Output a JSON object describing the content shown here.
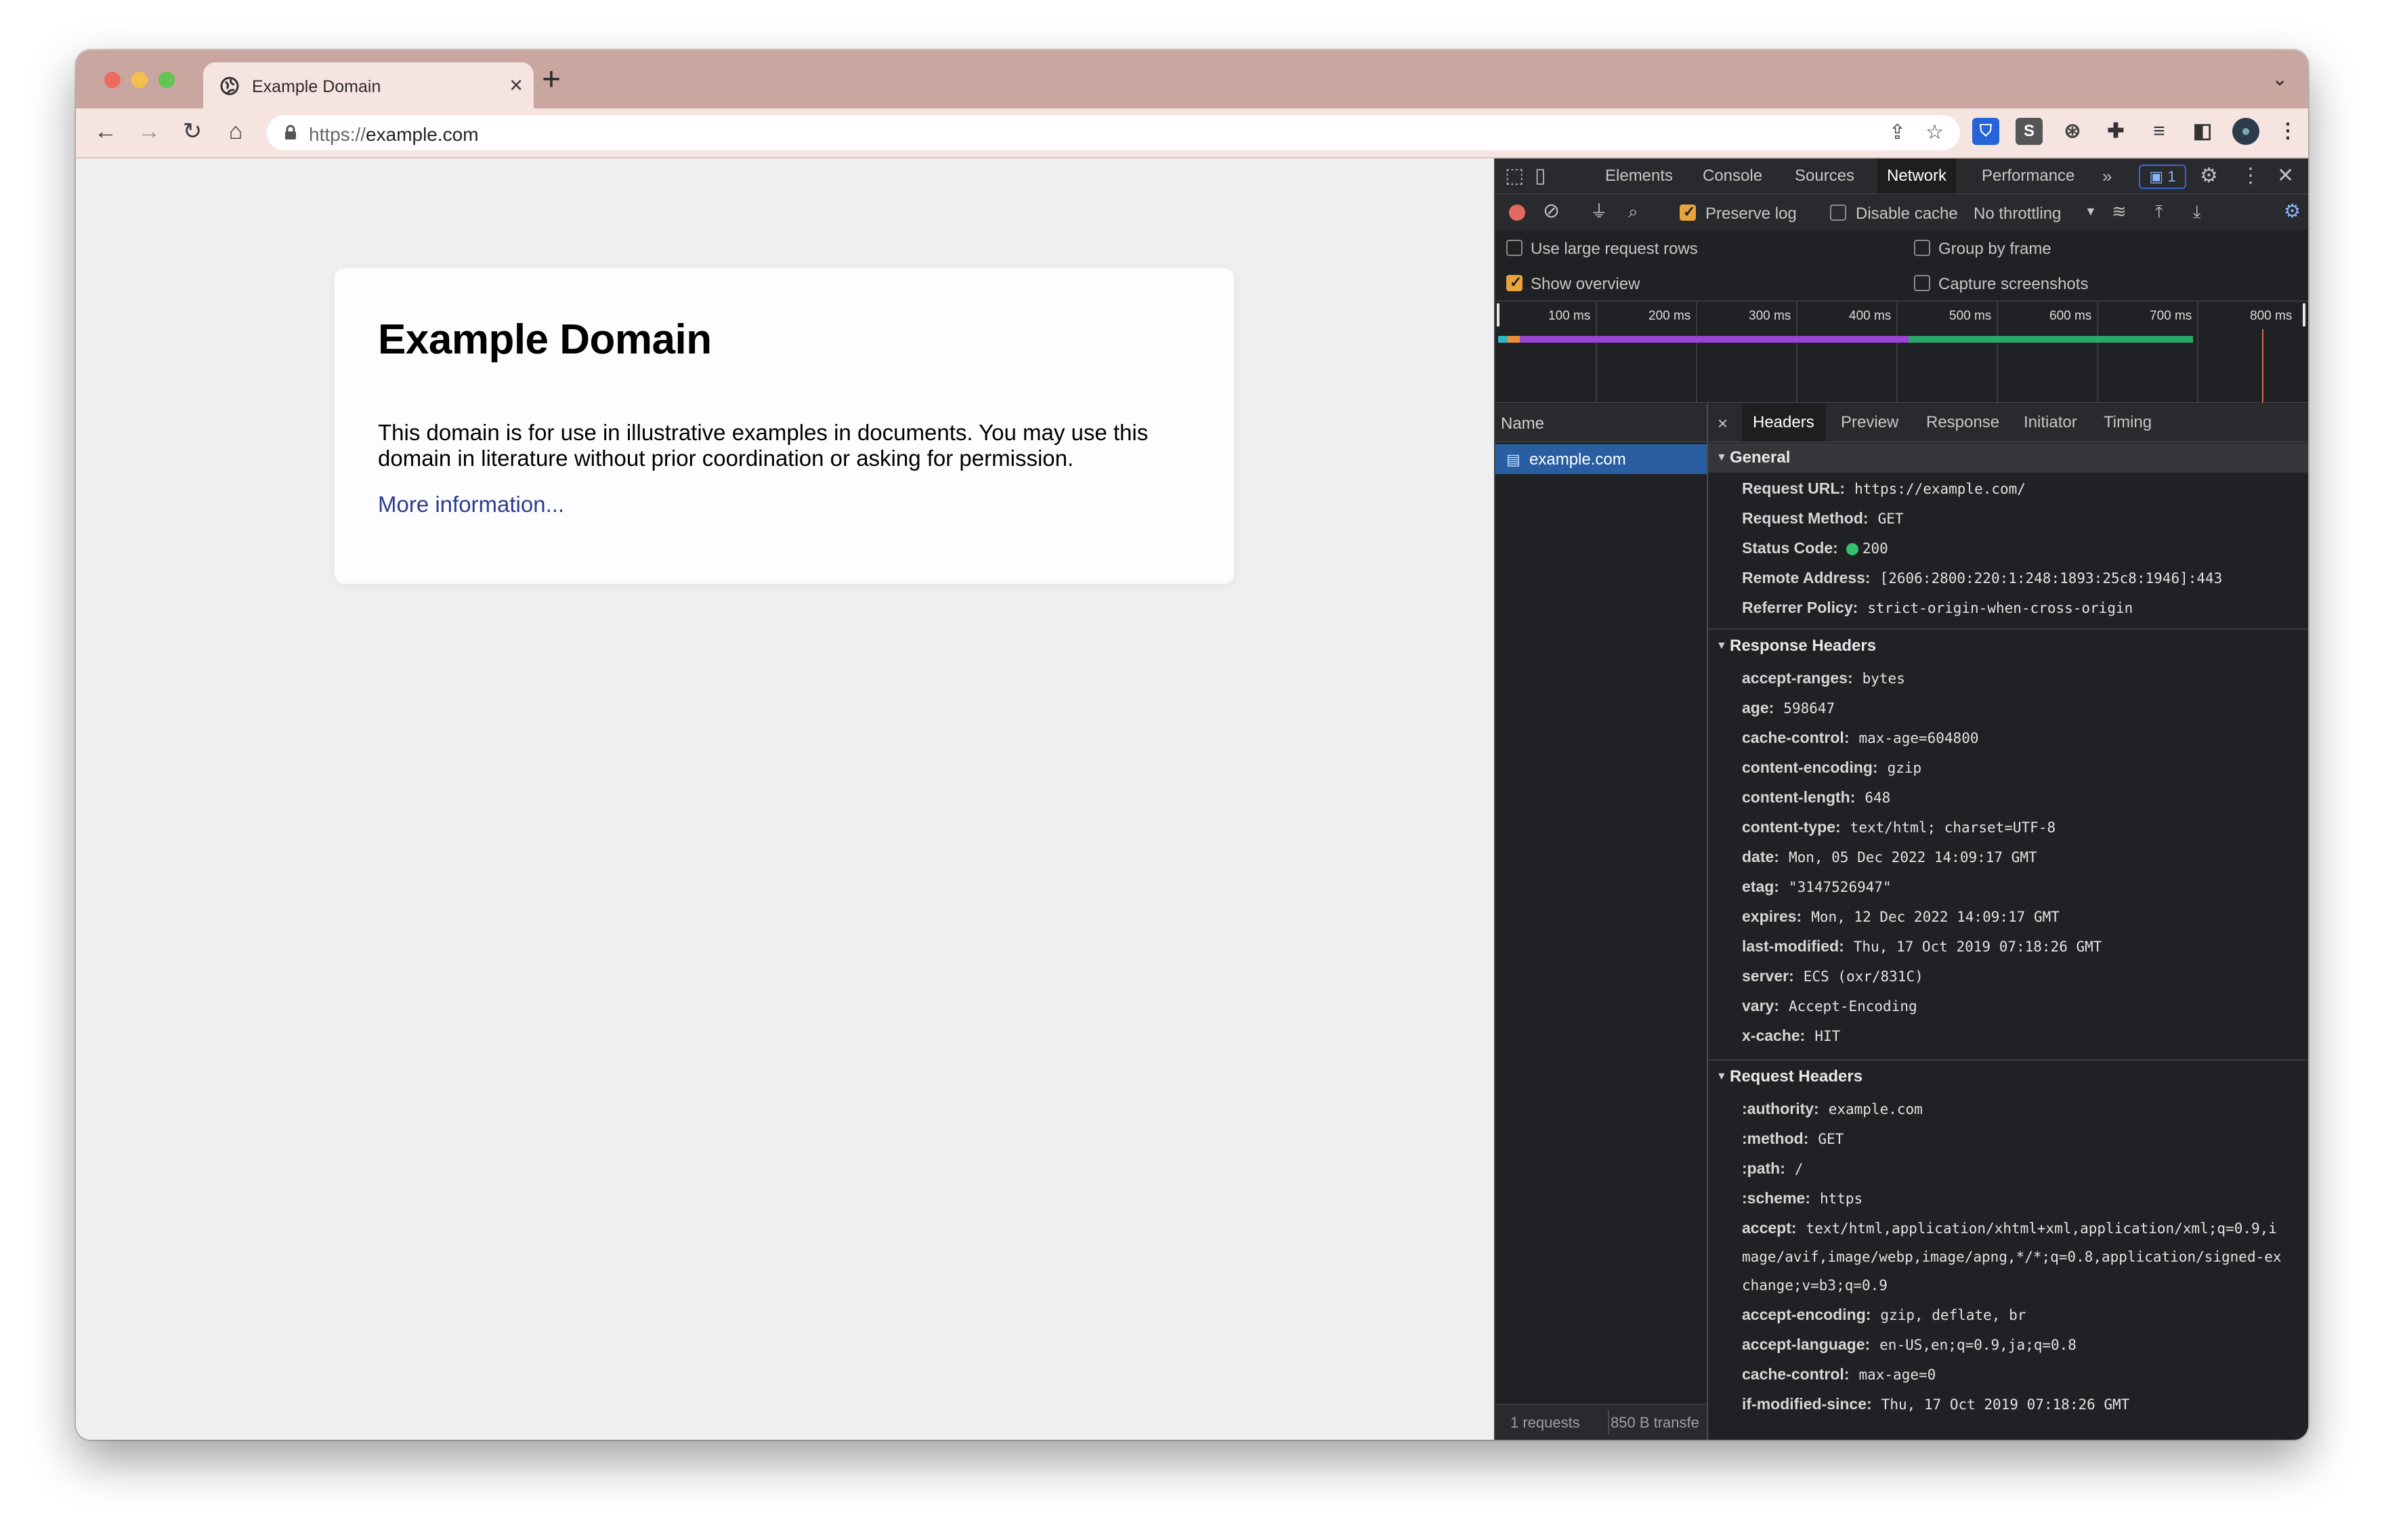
{
  "tab": {
    "title": "Example Domain"
  },
  "address_bar": {
    "scheme": "https://",
    "host": "example.com"
  },
  "page": {
    "heading": "Example Domain",
    "paragraph": "This domain is for use in illustrative examples in documents. You may use this domain in literature without prior coordination or asking for permission.",
    "link": "More information..."
  },
  "devtools": {
    "tabs": [
      "Elements",
      "Console",
      "Sources",
      "Network",
      "Performance"
    ],
    "active_tab": "Network",
    "issues_count": "1",
    "toolbar": {
      "preserve_log": "Preserve log",
      "disable_cache": "Disable cache",
      "throttling": "No throttling"
    },
    "options": {
      "large_rows": "Use large request rows",
      "group_by_frame": "Group by frame",
      "show_overview": "Show overview",
      "capture_screenshots": "Capture screenshots"
    },
    "overview_ticks": [
      "100 ms",
      "200 ms",
      "300 ms",
      "400 ms",
      "500 ms",
      "600 ms",
      "700 ms",
      "800 ms"
    ],
    "requests": {
      "column_name": "Name",
      "items": [
        "example.com"
      ],
      "footer_requests": "1 requests",
      "footer_transferred": "850 B transfe"
    },
    "detail_tabs": [
      "Headers",
      "Preview",
      "Response",
      "Initiator",
      "Timing"
    ],
    "general": {
      "title": "General",
      "rows": [
        {
          "key": "Request URL:",
          "value": "https://example.com/"
        },
        {
          "key": "Request Method:",
          "value": "GET"
        },
        {
          "key": "Status Code:",
          "value": "200"
        },
        {
          "key": "Remote Address:",
          "value": "[2606:2800:220:1:248:1893:25c8:1946]:443"
        },
        {
          "key": "Referrer Policy:",
          "value": "strict-origin-when-cross-origin"
        }
      ]
    },
    "response_headers": {
      "title": "Response Headers",
      "rows": [
        {
          "key": "accept-ranges:",
          "value": "bytes"
        },
        {
          "key": "age:",
          "value": "598647"
        },
        {
          "key": "cache-control:",
          "value": "max-age=604800"
        },
        {
          "key": "content-encoding:",
          "value": "gzip"
        },
        {
          "key": "content-length:",
          "value": "648"
        },
        {
          "key": "content-type:",
          "value": "text/html; charset=UTF-8"
        },
        {
          "key": "date:",
          "value": "Mon, 05 Dec 2022 14:09:17 GMT"
        },
        {
          "key": "etag:",
          "value": "\"3147526947\""
        },
        {
          "key": "expires:",
          "value": "Mon, 12 Dec 2022 14:09:17 GMT"
        },
        {
          "key": "last-modified:",
          "value": "Thu, 17 Oct 2019 07:18:26 GMT"
        },
        {
          "key": "server:",
          "value": "ECS (oxr/831C)"
        },
        {
          "key": "vary:",
          "value": "Accept-Encoding"
        },
        {
          "key": "x-cache:",
          "value": "HIT"
        }
      ]
    },
    "request_headers": {
      "title": "Request Headers",
      "rows": [
        {
          "key": ":authority:",
          "value": "example.com"
        },
        {
          "key": ":method:",
          "value": "GET"
        },
        {
          "key": ":path:",
          "value": "/"
        },
        {
          "key": ":scheme:",
          "value": "https"
        },
        {
          "key": "accept:",
          "value": "text/html,application/xhtml+xml,application/xml;q=0.9,i"
        },
        {
          "key": "",
          "value": "mage/avif,image/webp,image/apng,*/*;q=0.8,application/signed-ex"
        },
        {
          "key": "",
          "value": "change;v=b3;q=0.9"
        },
        {
          "key": "accept-encoding:",
          "value": "gzip, deflate, br"
        },
        {
          "key": "accept-language:",
          "value": "en-US,en;q=0.9,ja;q=0.8"
        },
        {
          "key": "cache-control:",
          "value": "max-age=0"
        },
        {
          "key": "if-modified-since:",
          "value": "Thu, 17 Oct 2019 07:18:26 GMT"
        }
      ]
    }
  }
}
